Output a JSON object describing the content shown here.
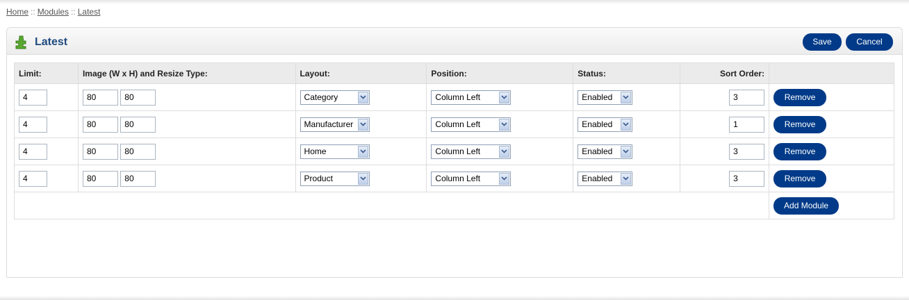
{
  "breadcrumb": {
    "items": [
      "Home",
      "Modules",
      "Latest"
    ],
    "separator": "::"
  },
  "heading": {
    "title": "Latest",
    "icon": "puzzle-piece-icon",
    "save_label": "Save",
    "cancel_label": "Cancel"
  },
  "table": {
    "headers": {
      "limit": "Limit:",
      "image": "Image (W x H) and Resize Type:",
      "layout": "Layout:",
      "position": "Position:",
      "status": "Status:",
      "sort_order": "Sort Order:"
    },
    "rows": [
      {
        "limit": "4",
        "width": "80",
        "height": "80",
        "layout": "Category",
        "position": "Column Left",
        "status": "Enabled",
        "sort_order": "3",
        "remove_label": "Remove"
      },
      {
        "limit": "4",
        "width": "80",
        "height": "80",
        "layout": "Manufacturer",
        "position": "Column Left",
        "status": "Enabled",
        "sort_order": "1",
        "remove_label": "Remove"
      },
      {
        "limit": "4",
        "width": "80",
        "height": "80",
        "layout": "Home",
        "position": "Column Left",
        "status": "Enabled",
        "sort_order": "3",
        "remove_label": "Remove"
      },
      {
        "limit": "4",
        "width": "80",
        "height": "80",
        "layout": "Product",
        "position": "Column Left",
        "status": "Enabled",
        "sort_order": "3",
        "remove_label": "Remove"
      }
    ],
    "add_module_label": "Add Module"
  },
  "colors": {
    "button": "#003a88",
    "title": "#1f4a7e",
    "header_bg": "#ebebeb"
  }
}
